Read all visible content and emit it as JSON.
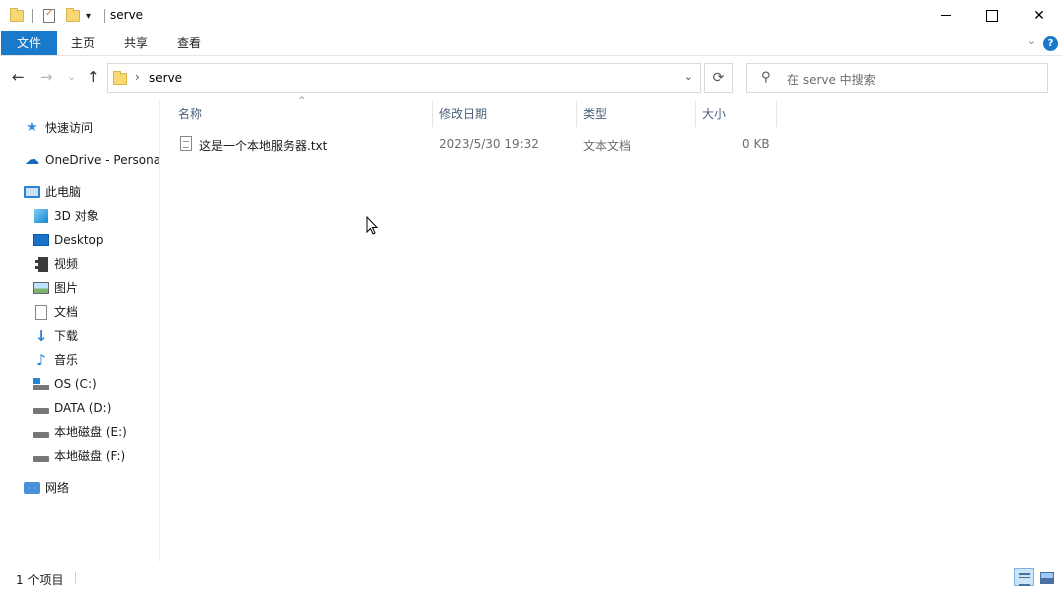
{
  "window": {
    "title": "serve",
    "minimize_glyph": "",
    "maximize_glyph": "",
    "close_glyph": "✕"
  },
  "ribbon": {
    "tabs": [
      {
        "label": "文件"
      },
      {
        "label": "主页"
      },
      {
        "label": "共享"
      },
      {
        "label": "查看"
      }
    ],
    "help_glyph": "?",
    "collapse_glyph": "⌄"
  },
  "nav": {
    "back_glyph": "←",
    "forward_glyph": "→",
    "recent_glyph": "⌄",
    "up_glyph": "↑"
  },
  "address": {
    "separator": "›",
    "path": "serve",
    "dropdown_glyph": "⌄",
    "refresh_glyph": "⟳"
  },
  "search": {
    "icon_glyph": "⚲",
    "placeholder": "在 serve 中搜索"
  },
  "sidebar": {
    "quick_access": "快速访问",
    "onedrive": "OneDrive - Persona",
    "this_pc": "此电脑",
    "items": [
      {
        "label": "3D 对象",
        "icon": "cube-icon"
      },
      {
        "label": "Desktop",
        "icon": "desktop-icon"
      },
      {
        "label": "视频",
        "icon": "video-icon"
      },
      {
        "label": "图片",
        "icon": "pictures-icon"
      },
      {
        "label": "文档",
        "icon": "documents-icon"
      },
      {
        "label": "下载",
        "icon": "download-icon"
      },
      {
        "label": "音乐",
        "icon": "music-icon"
      },
      {
        "label": "OS (C:)",
        "icon": "os-drive-icon"
      },
      {
        "label": "DATA (D:)",
        "icon": "drive-icon"
      },
      {
        "label": "本地磁盘 (E:)",
        "icon": "drive-icon"
      },
      {
        "label": "本地磁盘 (F:)",
        "icon": "drive-icon"
      }
    ],
    "network": "网络"
  },
  "columns": {
    "name": "名称",
    "modified": "修改日期",
    "type": "类型",
    "size": "大小",
    "sort_glyph": "^"
  },
  "files": [
    {
      "name": "这是一个本地服务器.txt",
      "modified": "2023/5/30 19:32",
      "type": "文本文档",
      "size": "0 KB"
    }
  ],
  "status": {
    "item_count": "1 个项目"
  },
  "colors": {
    "accent": "#1979ca",
    "folder": "#f8d775",
    "header_text": "#4c607a"
  }
}
